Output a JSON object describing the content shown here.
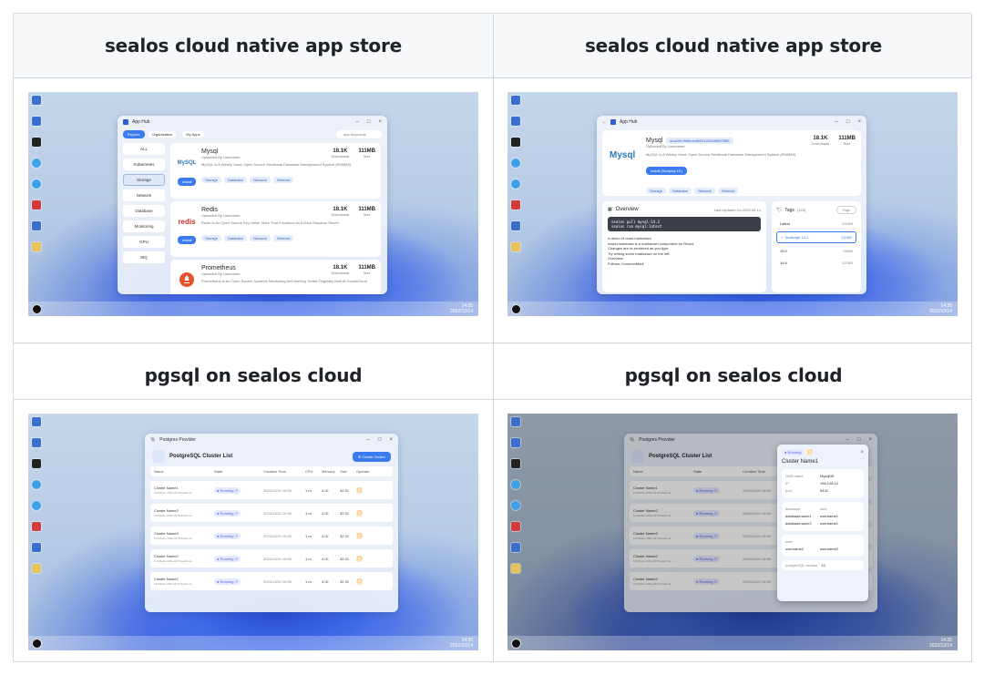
{
  "captions": {
    "top_left": "sealos cloud native app store",
    "top_right": "sealos cloud native app store",
    "bottom_left": "pgsql on sealos cloud",
    "bottom_right": "pgsql on sealos cloud"
  },
  "taskbar": {
    "time": "14:35",
    "date": "2022/12/14"
  },
  "apphub": {
    "title": "App Hub",
    "tabs": [
      "Explore",
      "Organization",
      "My Apps"
    ],
    "search_placeholder": "app keywords",
    "categories": [
      "ALL",
      "Kubernetes",
      "Storage",
      "Network",
      "Database",
      "Monitoring",
      "GPU",
      "MQ"
    ],
    "selected_category": "Storage",
    "install_label": "Install",
    "apps": [
      {
        "name": "Mysql",
        "logo": "MySQL",
        "uploaded": "Uploaded By Username",
        "desc": "MySQL Is A Widely Used, Open Source Relational Database Management System (RDBMS)",
        "downloads": "18.1K",
        "downloads_label": "Downloads",
        "size": "111MB",
        "size_label": "Size",
        "tags": [
          "Storage",
          "Database",
          "Network",
          "Network"
        ]
      },
      {
        "name": "Redis",
        "logo": "redis",
        "uploaded": "Uploaded By Username",
        "desc": "Redis Is An Open Source Key-Value Store That Functions As A Data Structure Server",
        "downloads": "18.1K",
        "downloads_label": "Downloads",
        "size": "111MB",
        "size_label": "Size",
        "tags": [
          "Storage",
          "Database",
          "Network",
          "Network"
        ]
      },
      {
        "name": "Prometheus",
        "logo": "",
        "uploaded": "Uploaded By Username",
        "desc": "Prometheus Is An Open Source Systems Monitoring And Alerting Toolkit Originally Built At SoundCloud",
        "downloads": "18.1K",
        "downloads_label": "Downloads",
        "size": "111MB",
        "size_label": "Size",
        "tags": []
      }
    ]
  },
  "mysql_detail": {
    "title": "App Hub",
    "name": "Mysql",
    "hash": "sha256:fffd5e4e8f0f1e2f3f4f5f6f7f8f9",
    "uploaded": "Uploaded By Username",
    "desc": "MySQL Is A Widely Used, Open Source Relational Database Management System (RDBMS)",
    "install_label": "Install (Sealpkg:15.)",
    "downloads": "18.1K",
    "downloads_label": "Downloads",
    "size": "111MB",
    "size_label": "Size",
    "tags": [
      "Storage",
      "Database",
      "Network",
      "Network"
    ],
    "overview_title": "Overview",
    "last_updated": "Last Updated On 2022.08.14",
    "code_lines": [
      "sealos pull mysql:14.2",
      "sealos run mysql:latest"
    ],
    "md_lines": [
      "A demo of react-markdown",
      "react-markdown is a markdown component for React.",
      "Changes are re-rendered as you type.",
      "Try writing some markdown on the left.",
      "Overview",
      "Follows CommonMark"
    ],
    "tags_title": "Tags",
    "tags_count": "(143)",
    "tags_search": "Tags",
    "versions": [
      {
        "name": "Latest",
        "size": "111MB"
      },
      {
        "name": "Sealkage 13.1",
        "size": "111MB"
      },
      {
        "name": "15.0",
        "size": "56MB"
      },
      {
        "name": "14.6",
        "size": "111MB"
      }
    ]
  },
  "pg_list": {
    "title": "Postgres Provider",
    "heading": "PostgreSQL Cluster List",
    "create_label": "Create Cluster",
    "columns": [
      "Name",
      "State",
      "Creation Time",
      "CPU",
      "Memory",
      "Size",
      "Operate"
    ],
    "rows": [
      {
        "name": "Cluster Name1",
        "id": "12345abc-345a-4678-9def0-4a",
        "state": "Running",
        "time": "2022/11/20 10:55",
        "cpu": "1 m",
        "mem": "4 Gi",
        "size": "32 Gi"
      },
      {
        "name": "Cluster Name2",
        "id": "12345abc-345a-4678-9def0-4a",
        "state": "Running",
        "time": "2022/11/20 10:55",
        "cpu": "1 m",
        "mem": "4 Gi",
        "size": "32 Gi"
      },
      {
        "name": "Cluster Name3",
        "id": "12345abc-345a-4678-9def0-4a",
        "state": "Running",
        "time": "2022/11/20 10:55",
        "cpu": "1 m",
        "mem": "4 Gi",
        "size": "32 Gi"
      },
      {
        "name": "Cluster Name2",
        "id": "12345abc-345a-4678-9def0-4a",
        "state": "Running",
        "time": "2022/11/20 10:55",
        "cpu": "1 m",
        "mem": "4 Gi",
        "size": "32 Gi"
      },
      {
        "name": "Cluster Name2",
        "id": "12345abc-345a-4678-9def0-4a",
        "state": "Running",
        "time": "2022/11/20 10:55",
        "cpu": "1 m",
        "mem": "4 Gi",
        "size": "32 Gi"
      }
    ]
  },
  "pg_detail": {
    "state": "Running",
    "name": "Cluster Name1",
    "fields": [
      {
        "k": "DNS name",
        "v": "Mysql08"
      },
      {
        "k": "IP",
        "v": "198.128.12"
      },
      {
        "k": "port",
        "v": "5432"
      }
    ],
    "db_header": [
      "database",
      "user"
    ],
    "db_rows": [
      [
        "databasename1",
        "username1"
      ],
      [
        "databasename2",
        "username1"
      ]
    ],
    "user_header": "user",
    "user_value": "username2",
    "user_value2": "username2",
    "postgres_version_label": "postgreSQL version",
    "postgres_version": "13"
  }
}
